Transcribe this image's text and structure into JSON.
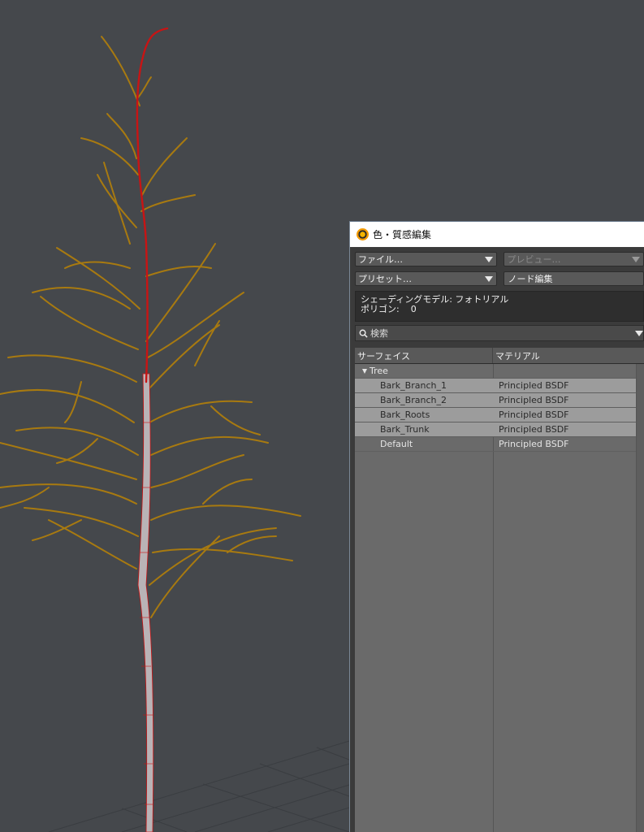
{
  "window": {
    "title": "色・質感編集"
  },
  "toolbar": {
    "file_label": "ファイル…",
    "preview_label": "プレビュー…",
    "preset_label": "プリセット…",
    "node_edit_label": "ノード編集"
  },
  "info": {
    "shading_line": "シェーディングモデル: フォトリアル",
    "polygon_line": "ポリゴン:    0"
  },
  "search": {
    "label": "検索"
  },
  "table": {
    "headers": {
      "surface": "サーフェイス",
      "material": "マテリアル"
    },
    "group": {
      "name": "Tree"
    },
    "rows": [
      {
        "surface": "Bark_Branch_1",
        "material": "Principled BSDF",
        "selected": true
      },
      {
        "surface": "Bark_Branch_2",
        "material": "Principled BSDF",
        "selected": true
      },
      {
        "surface": "Bark_Roots",
        "material": "Principled BSDF",
        "selected": true
      },
      {
        "surface": "Bark_Trunk",
        "material": "Principled BSDF",
        "selected": true
      },
      {
        "surface": "Default",
        "material": "Principled BSDF",
        "selected": false
      }
    ]
  },
  "colors": {
    "viewport_bg": "#45484c",
    "branch": "#a87a10",
    "selected_edge": "#c81414",
    "trunk": "#b9b3b6"
  },
  "icons": {
    "logo": "app-logo-icon",
    "search": "search-icon",
    "expand": "triangle-down-icon",
    "dropdown": "chevron-down-icon"
  }
}
